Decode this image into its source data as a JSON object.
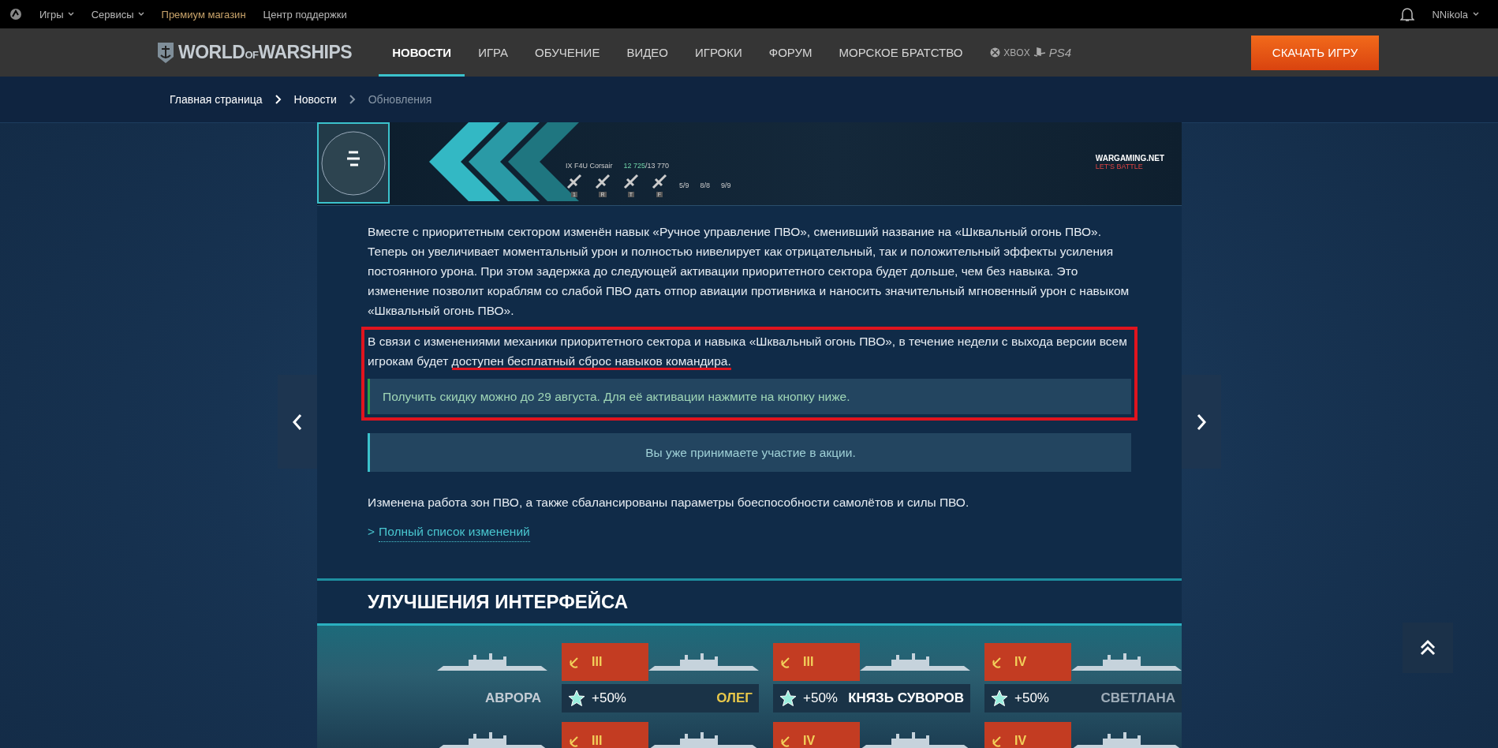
{
  "top_bar": {
    "menu": [
      {
        "label": "Игры",
        "kind": "dropdown"
      },
      {
        "label": "Сервисы",
        "kind": "dropdown"
      },
      {
        "label": "Премиум магазин",
        "kind": "premium"
      },
      {
        "label": "Центр поддержки",
        "kind": "plain"
      }
    ],
    "user": "NNikola"
  },
  "nav": {
    "logo": {
      "left": "WORLD",
      "middle": "OF",
      "right": "WARSHIPS"
    },
    "items": [
      {
        "label": "НОВОСТИ",
        "selected": true
      },
      {
        "label": "ИГРА",
        "selected": false
      },
      {
        "label": "ОБУЧЕНИЕ",
        "selected": false
      },
      {
        "label": "ВИДЕО",
        "selected": false
      },
      {
        "label": "ИГРОКИ",
        "selected": false
      },
      {
        "label": "ФОРУМ",
        "selected": false
      },
      {
        "label": "МОРСКОЕ БРАТСТВО",
        "selected": false
      }
    ],
    "platforms": [
      "XBOX",
      "PS4"
    ],
    "download": "СКАЧАТЬ ИГРУ"
  },
  "breadcrumbs": [
    {
      "label": "Главная страница",
      "current": false
    },
    {
      "label": "Новости",
      "current": false
    },
    {
      "label": "Обновления",
      "current": true
    }
  ],
  "game_screenshot": {
    "plane": "IX F4U Corsair",
    "hp": "12 725",
    "hp_max": "/13 770",
    "keys": [
      "1",
      "R",
      "T",
      "F"
    ],
    "counts": [
      "5/9",
      "8/8",
      "9/9"
    ],
    "brand": "WARGAMING.NET",
    "tagline": "LET'S BATTLE"
  },
  "article": {
    "paragraph_1": "Вместе с приоритетным сектором изменён навык «Ручное управление ПВО», сменивший название на «Шквальный огонь ПВО». Теперь он увеличивает моментальный урон и полностью нивелирует как отрицательный, так и положительный эффекты усиления постоянного урона. При этом задержка до следующей активации приоритетного сектора будет дольше, чем без навыка. Это изменение позволит кораблям со слабой ПВО дать отпор авиации противника и наносить значительный мгновенный урон с навыком «Шквальный огонь ПВО».",
    "paragraph_2_start": "В связи с изменениями механики приоритетного сектора и навыка «Шквальный огонь ПВО», в течение недели с выхода версии всем игрокам будет ",
    "paragraph_2_marked": "доступен бесплатный сброс навыков командира.",
    "notice": "Получить скидку можно до 29 августа. Для её активации нажмите на кнопку ниже.",
    "participation": "Вы уже принимаете участие в акции.",
    "paragraph_3": "Изменена работа зон ПВО, а также сбалансированы параметры боеспособности самолётов и силы ПВО.",
    "link_marker": ">",
    "link": "Полный список изменений"
  },
  "section_heading": "УЛУЧШЕНИЯ ИНТЕРФЕЙСА",
  "ship_rows": [
    [
      {
        "kind": "plain",
        "name": "АВРОРА",
        "color": "#c4ccd4"
      },
      {
        "kind": "flag",
        "tier": "III",
        "bonus": "+50%",
        "name": "ОЛЕГ",
        "color": "#e8c84a"
      },
      {
        "kind": "flag",
        "tier": "III",
        "bonus": "+50%",
        "name": "КНЯЗЬ СУВОРОВ",
        "color": "#ffffff"
      },
      {
        "kind": "flag",
        "tier": "IV",
        "bonus": "+50%",
        "name": "СВЕТЛАНА",
        "color": "#9fadb9"
      }
    ],
    [
      {
        "kind": "plain"
      },
      {
        "kind": "flag",
        "tier": "III"
      },
      {
        "kind": "flag",
        "tier": "IV"
      },
      {
        "kind": "flag",
        "tier": "IV"
      }
    ]
  ]
}
